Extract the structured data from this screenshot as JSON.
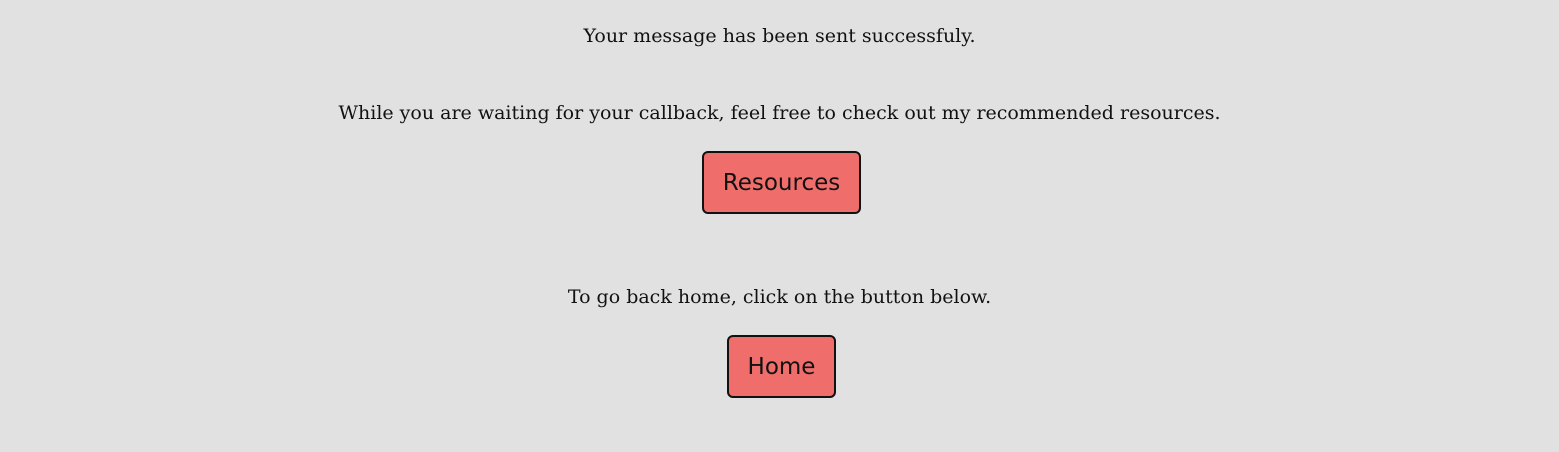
{
  "messages": {
    "sent": "Your message has been sent successfuly.",
    "waiting": "While you are waiting for your callback, feel free to check out my recommended resources.",
    "home_hint": "To go back home, click on the button below."
  },
  "buttons": {
    "resources_label": "Resources",
    "home_label": "Home"
  },
  "colors": {
    "background": "#e1e1e1",
    "button_fill": "#ef6e6c",
    "button_border": "#111111",
    "text": "#111111"
  }
}
